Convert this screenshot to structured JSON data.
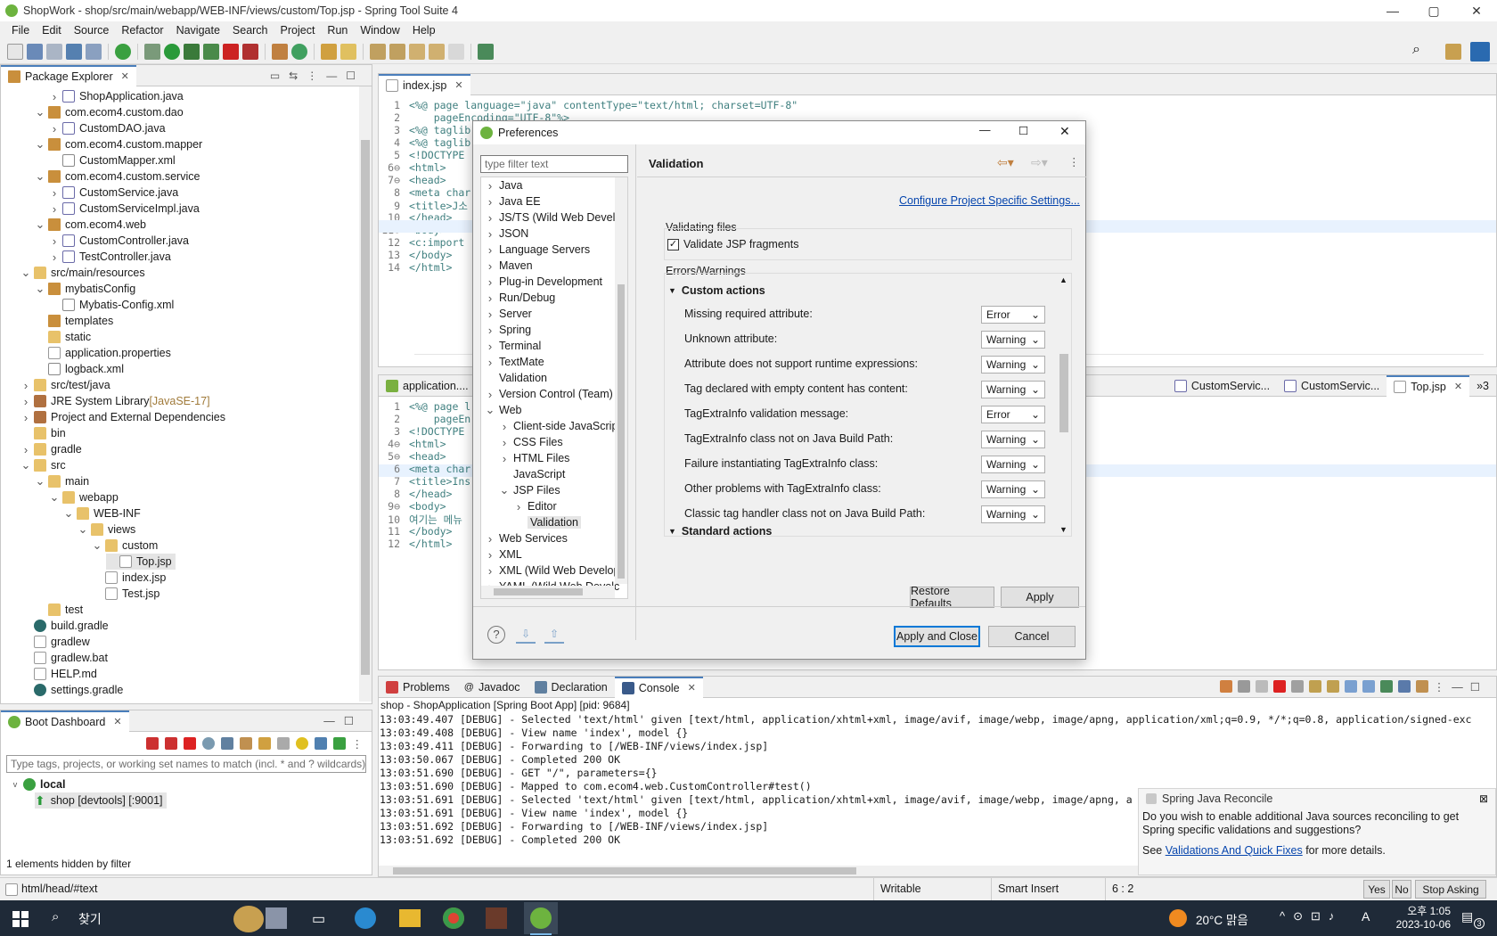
{
  "window": {
    "title": "ShopWork - shop/src/main/webapp/WEB-INF/views/custom/Top.jsp - Spring Tool Suite 4",
    "minimize": "—",
    "maximize": "▢",
    "close": "✕"
  },
  "menu": [
    "File",
    "Edit",
    "Source",
    "Refactor",
    "Navigate",
    "Search",
    "Project",
    "Run",
    "Window",
    "Help"
  ],
  "package_explorer": {
    "tab": "Package Explorer",
    "items": [
      {
        "label": "ShopApplication.java",
        "depth": 4,
        "icon": "java",
        "twisty": ">"
      },
      {
        "label": "com.ecom4.custom.dao",
        "depth": 3,
        "icon": "pkg",
        "twisty": "v"
      },
      {
        "label": "CustomDAO.java",
        "depth": 4,
        "icon": "java",
        "twisty": ">"
      },
      {
        "label": "com.ecom4.custom.mapper",
        "depth": 3,
        "icon": "pkg",
        "twisty": "v"
      },
      {
        "label": "CustomMapper.xml",
        "depth": 4,
        "icon": "xml",
        "twisty": ""
      },
      {
        "label": "com.ecom4.custom.service",
        "depth": 3,
        "icon": "pkg",
        "twisty": "v"
      },
      {
        "label": "CustomService.java",
        "depth": 4,
        "icon": "java",
        "twisty": ">"
      },
      {
        "label": "CustomServiceImpl.java",
        "depth": 4,
        "icon": "java",
        "twisty": ">"
      },
      {
        "label": "com.ecom4.web",
        "depth": 3,
        "icon": "pkg",
        "twisty": "v"
      },
      {
        "label": "CustomController.java",
        "depth": 4,
        "icon": "java",
        "twisty": ">"
      },
      {
        "label": "TestController.java",
        "depth": 4,
        "icon": "java",
        "twisty": ">"
      },
      {
        "label": "src/main/resources",
        "depth": 2,
        "icon": "folder",
        "twisty": "v"
      },
      {
        "label": "mybatisConfig",
        "depth": 3,
        "icon": "pkg",
        "twisty": "v"
      },
      {
        "label": "Mybatis-Config.xml",
        "depth": 4,
        "icon": "xml",
        "twisty": ""
      },
      {
        "label": "templates",
        "depth": 3,
        "icon": "pkg",
        "twisty": ""
      },
      {
        "label": "static",
        "depth": 3,
        "icon": "folder",
        "twisty": ""
      },
      {
        "label": "application.properties",
        "depth": 3,
        "icon": "file",
        "twisty": ""
      },
      {
        "label": "logback.xml",
        "depth": 3,
        "icon": "xml",
        "twisty": ""
      },
      {
        "label": "src/test/java",
        "depth": 2,
        "icon": "folder",
        "twisty": ">"
      },
      {
        "label": "JRE System Library",
        "decor": " [JavaSE-17]",
        "depth": 2,
        "icon": "lib",
        "twisty": ">"
      },
      {
        "label": "Project and External Dependencies",
        "depth": 2,
        "icon": "lib",
        "twisty": ">"
      },
      {
        "label": "bin",
        "depth": 2,
        "icon": "folder",
        "twisty": ""
      },
      {
        "label": "gradle",
        "depth": 2,
        "icon": "folder",
        "twisty": ">"
      },
      {
        "label": "src",
        "depth": 2,
        "icon": "folder",
        "twisty": "v"
      },
      {
        "label": "main",
        "depth": 3,
        "icon": "folder",
        "twisty": "v"
      },
      {
        "label": "webapp",
        "depth": 4,
        "icon": "folder",
        "twisty": "v"
      },
      {
        "label": "WEB-INF",
        "depth": 5,
        "icon": "folder",
        "twisty": "v"
      },
      {
        "label": "views",
        "depth": 6,
        "icon": "folder",
        "twisty": "v"
      },
      {
        "label": "custom",
        "depth": 7,
        "icon": "folder",
        "twisty": "v"
      },
      {
        "label": "Top.jsp",
        "depth": 8,
        "icon": "file",
        "twisty": "",
        "selected": true
      },
      {
        "label": "index.jsp",
        "depth": 7,
        "icon": "file",
        "twisty": ""
      },
      {
        "label": "Test.jsp",
        "depth": 7,
        "icon": "file",
        "twisty": ""
      },
      {
        "label": "test",
        "depth": 3,
        "icon": "folder",
        "twisty": ""
      },
      {
        "label": "build.gradle",
        "depth": 2,
        "icon": "gradle",
        "twisty": ""
      },
      {
        "label": "gradlew",
        "depth": 2,
        "icon": "file",
        "twisty": ""
      },
      {
        "label": "gradlew.bat",
        "depth": 2,
        "icon": "file",
        "twisty": ""
      },
      {
        "label": "HELP.md",
        "depth": 2,
        "icon": "file",
        "twisty": ""
      },
      {
        "label": "settings.gradle",
        "depth": 2,
        "icon": "gradle",
        "twisty": ""
      }
    ]
  },
  "boot_dashboard": {
    "tab": "Boot Dashboard",
    "filter_placeholder": "Type tags, projects, or working set names to match (incl. * and ? wildcards)",
    "group": "local",
    "app": "shop [devtools] [:9001]",
    "hidden_note": "1 elements hidden by filter"
  },
  "editor_top": {
    "tab": "index.jsp",
    "lines": [
      {
        "n": "1",
        "t": "<%@ page language=\"java\" contentType=\"text/html; charset=UTF-8\""
      },
      {
        "n": "2",
        "t": "    pageEncoding=\"UTF-8\"%>"
      },
      {
        "n": "3",
        "t": "<%@ taglib"
      },
      {
        "n": "4",
        "t": "<%@ taglib"
      },
      {
        "n": "5",
        "t": "<!DOCTYPE"
      },
      {
        "n": "6⊖",
        "t": "<html>"
      },
      {
        "n": "7⊖",
        "t": "<head>"
      },
      {
        "n": "8",
        "t": "<meta char"
      },
      {
        "n": "9",
        "t": "<title>J소"
      },
      {
        "n": "10",
        "t": "</head>"
      },
      {
        "n": "11⊖",
        "t": "<body>"
      },
      {
        "n": "12",
        "t": "<c:import"
      },
      {
        "n": "13",
        "t": "</body>"
      },
      {
        "n": "14",
        "t": "</html>"
      }
    ]
  },
  "editor_bottom": {
    "tab_left": "application....",
    "tabs_right": [
      "CustomServic...",
      "CustomServic...",
      "Top.jsp"
    ],
    "overflow": "»3",
    "lines": [
      {
        "n": "1",
        "t": "<%@ page l"
      },
      {
        "n": "2",
        "t": "    pageEn"
      },
      {
        "n": "3",
        "t": "<!DOCTYPE"
      },
      {
        "n": "4⊖",
        "t": "<html>"
      },
      {
        "n": "5⊖",
        "t": "<head>"
      },
      {
        "n": "6",
        "t": "<meta char"
      },
      {
        "n": "7",
        "t": "<title>Ins"
      },
      {
        "n": "8",
        "t": "</head>"
      },
      {
        "n": "9⊖",
        "t": "<body>"
      },
      {
        "n": "10",
        "t": "여기는 메뉴"
      },
      {
        "n": "11",
        "t": "</body>"
      },
      {
        "n": "12",
        "t": "</html>"
      }
    ]
  },
  "preferences": {
    "title": "Preferences",
    "filter_placeholder": "type filter text",
    "tree": [
      {
        "label": "Java",
        "twisty": ">",
        "depth": 0
      },
      {
        "label": "Java EE",
        "twisty": ">",
        "depth": 0
      },
      {
        "label": "JS/TS (Wild Web Develc",
        "twisty": ">",
        "depth": 0
      },
      {
        "label": "JSON",
        "twisty": ">",
        "depth": 0
      },
      {
        "label": "Language Servers",
        "twisty": ">",
        "depth": 0
      },
      {
        "label": "Maven",
        "twisty": ">",
        "depth": 0
      },
      {
        "label": "Plug-in Development",
        "twisty": ">",
        "depth": 0
      },
      {
        "label": "Run/Debug",
        "twisty": ">",
        "depth": 0
      },
      {
        "label": "Server",
        "twisty": ">",
        "depth": 0
      },
      {
        "label": "Spring",
        "twisty": ">",
        "depth": 0
      },
      {
        "label": "Terminal",
        "twisty": ">",
        "depth": 0
      },
      {
        "label": "TextMate",
        "twisty": ">",
        "depth": 0
      },
      {
        "label": "Validation",
        "twisty": "",
        "depth": 0
      },
      {
        "label": "Version Control (Team)",
        "twisty": ">",
        "depth": 0
      },
      {
        "label": "Web",
        "twisty": "v",
        "depth": 0
      },
      {
        "label": "Client-side JavaScript",
        "twisty": ">",
        "depth": 1
      },
      {
        "label": "CSS Files",
        "twisty": ">",
        "depth": 1
      },
      {
        "label": "HTML Files",
        "twisty": ">",
        "depth": 1
      },
      {
        "label": "JavaScript",
        "twisty": "",
        "depth": 1
      },
      {
        "label": "JSP Files",
        "twisty": "v",
        "depth": 1
      },
      {
        "label": "Editor",
        "twisty": ">",
        "depth": 2
      },
      {
        "label": "Validation",
        "twisty": "",
        "depth": 2,
        "selected": true
      },
      {
        "label": "Web Services",
        "twisty": ">",
        "depth": 0
      },
      {
        "label": "XML",
        "twisty": ">",
        "depth": 0
      },
      {
        "label": "XML (Wild Web Develop",
        "twisty": ">",
        "depth": 0
      },
      {
        "label": "YAML (Wild Web Develc",
        "twisty": ">",
        "depth": 0
      }
    ],
    "page_title": "Validation",
    "configure_link": "Configure Project Specific Settings...",
    "validating_files_label": "Validating files",
    "validate_fragments_label": "Validate JSP fragments",
    "errors_warnings_label": "Errors/Warnings",
    "section_custom": "Custom actions",
    "section_standard": "Standard actions",
    "settings": [
      {
        "label": "Missing required attribute:",
        "value": "Error"
      },
      {
        "label": "Unknown attribute:",
        "value": "Warning"
      },
      {
        "label": "Attribute does not support runtime expressions:",
        "value": "Warning"
      },
      {
        "label": "Tag declared with empty content has content:",
        "value": "Warning"
      },
      {
        "label": "TagExtraInfo validation message:",
        "value": "Error"
      },
      {
        "label": "TagExtraInfo class not on Java Build Path:",
        "value": "Warning"
      },
      {
        "label": "Failure instantiating TagExtraInfo class:",
        "value": "Warning"
      },
      {
        "label": "Other problems with TagExtraInfo class:",
        "value": "Warning"
      },
      {
        "label": "Classic tag handler class not on Java Build Path:",
        "value": "Warning"
      }
    ],
    "restore_defaults": "Restore Defaults",
    "apply": "Apply",
    "apply_and_close": "Apply and Close",
    "cancel": "Cancel"
  },
  "bottom_panel": {
    "tabs": [
      "Problems",
      "Javadoc",
      "Declaration",
      "Console"
    ],
    "console_header": "shop - ShopApplication [Spring Boot App]  [pid: 9684]",
    "lines": [
      "13:03:49.407 [DEBUG] - Selected 'text/html' given [text/html, application/xhtml+xml, image/avif, image/webp, image/apng, application/xml;q=0.9, */*;q=0.8, application/signed-exc",
      "13:03:49.408 [DEBUG] - View name 'index', model {}",
      "13:03:49.411 [DEBUG] - Forwarding to [/WEB-INF/views/index.jsp]",
      "13:03:50.067 [DEBUG] - Completed 200 OK",
      "13:03:51.690 [DEBUG] - GET \"/\", parameters={}",
      "13:03:51.690 [DEBUG] - Mapped to com.ecom4.web.CustomController#test()",
      "13:03:51.691 [DEBUG] - Selected 'text/html' given [text/html, application/xhtml+xml, image/avif, image/webp, image/apng, a",
      "13:03:51.691 [DEBUG] - View name 'index', model {}",
      "13:03:51.692 [DEBUG] - Forwarding to [/WEB-INF/views/index.jsp]",
      "13:03:51.692 [DEBUG] - Completed 200 OK"
    ]
  },
  "notification": {
    "title": "Spring Java Reconcile",
    "body": "Do you wish to enable additional Java sources reconciling to get Spring specific validations and suggestions?",
    "see": "See ",
    "link": "Validations And Quick Fixes",
    "after": " for more details.",
    "yes": "Yes",
    "no": "No",
    "stop": "Stop Asking"
  },
  "status_bar": {
    "path": "html/head/#text",
    "writable": "Writable",
    "insert": "Smart Insert",
    "position": "6 : 2"
  },
  "taskbar": {
    "search": "찾기",
    "weather": "20°C  맑음",
    "ime": "A",
    "time": "오후 1:05",
    "date": "2023-10-06",
    "notif_count": "3"
  },
  "colors": {
    "accent": "#0078d7",
    "spring_green": "#6db33f",
    "selection": "#cce8ff",
    "taskbar": "#1f2a38"
  }
}
